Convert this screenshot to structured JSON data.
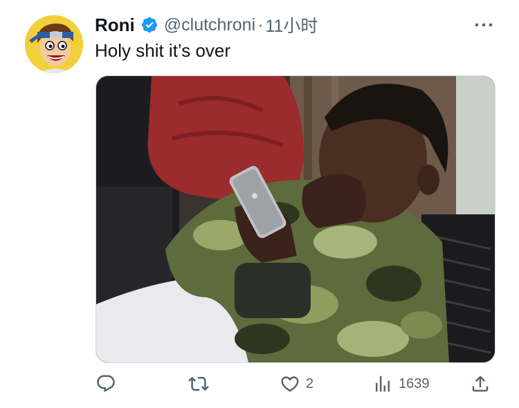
{
  "tweet": {
    "author": {
      "display_name": "Roni",
      "handle": "@clutchroni",
      "verified": true,
      "avatar_icon": "cartoon-avatar-icon"
    },
    "separator": "·",
    "timestamp": "11小时",
    "text": "Holy shit it’s over",
    "media": {
      "type": "photo"
    },
    "actions": {
      "reply": {
        "icon": "reply-icon",
        "count": ""
      },
      "retweet": {
        "icon": "retweet-icon",
        "count": ""
      },
      "like": {
        "icon": "heart-icon",
        "count": "2"
      },
      "views": {
        "icon": "views-chart-icon",
        "count": "1639"
      },
      "share": {
        "icon": "share-icon",
        "count": ""
      }
    }
  },
  "colors": {
    "text": "#0f1419",
    "secondary_text": "#536471",
    "verified_blue": "#1d9bf0",
    "avatar_bg": "#f2d03b",
    "border": "#cfd9de"
  }
}
